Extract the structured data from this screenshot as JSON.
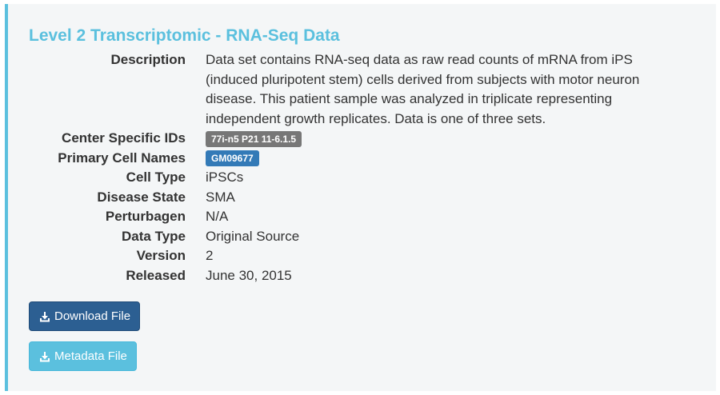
{
  "dataset": {
    "title": "Level 2 Transcriptomic - RNA-Seq Data",
    "fields": {
      "description": {
        "label": "Description",
        "value": "Data set contains RNA-seq data as raw read counts of mRNA from iPS (induced pluripotent stem) cells derived from subjects with motor neuron disease. This patient sample was analyzed in triplicate representing independent growth replicates. Data is one of three sets."
      },
      "center_specific_ids": {
        "label": "Center Specific IDs",
        "badge": "77i-n5 P21 11-6.1.5"
      },
      "primary_cell_names": {
        "label": "Primary Cell Names",
        "badge": "GM09677"
      },
      "cell_type": {
        "label": "Cell Type",
        "value": "iPSCs"
      },
      "disease_state": {
        "label": "Disease State",
        "value": "SMA"
      },
      "perturbagen": {
        "label": "Perturbagen",
        "value": "N/A"
      },
      "data_type": {
        "label": "Data Type",
        "value": "Original Source"
      },
      "version": {
        "label": "Version",
        "value": "2"
      },
      "released": {
        "label": "Released",
        "value": "June 30, 2015"
      }
    }
  },
  "buttons": {
    "download": {
      "label": "Download File",
      "icon": "download-icon"
    },
    "metadata": {
      "label": "Metadata File",
      "icon": "download-icon"
    }
  },
  "colors": {
    "accent": "#5bc0de",
    "primary_button": "#2c5f92",
    "info_button": "#5bc0de",
    "badge_gray": "#777777",
    "badge_blue": "#337ab7",
    "panel_background": "#f4f6f7"
  }
}
